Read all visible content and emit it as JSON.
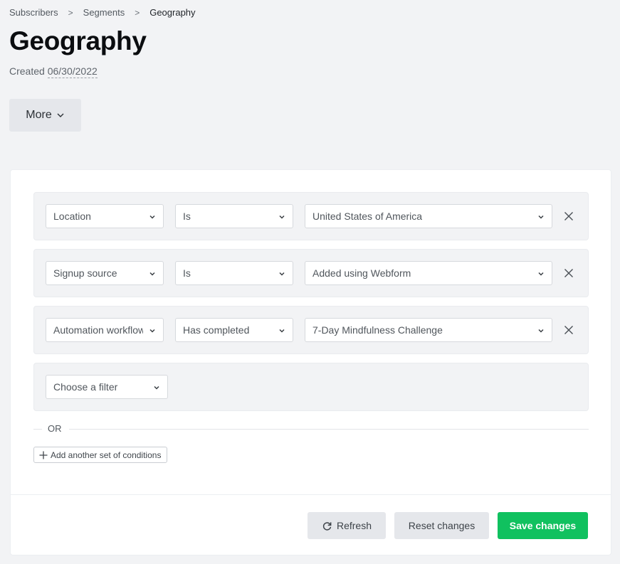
{
  "breadcrumb": {
    "items": [
      "Subscribers",
      "Segments",
      "Geography"
    ],
    "separator": ">"
  },
  "header": {
    "title": "Geography",
    "created_label": "Created",
    "created_date": "06/30/2022",
    "more_label": "More"
  },
  "conditions": [
    {
      "field": "Location",
      "operator": "Is",
      "value": "United States of America"
    },
    {
      "field": "Signup source",
      "operator": "Is",
      "value": "Added using Webform"
    },
    {
      "field": "Automation workflow",
      "operator": "Has completed",
      "value": "7-Day Mindfulness Challenge"
    }
  ],
  "new_filter": {
    "placeholder": "Choose a filter"
  },
  "or_label": "OR",
  "add_set_label": "Add another set of conditions",
  "footer": {
    "refresh_label": "Refresh",
    "reset_label": "Reset changes",
    "save_label": "Save changes"
  },
  "colors": {
    "primary": "#10c15f",
    "background": "#f2f3f5",
    "neutral_button": "#e5e7eb"
  },
  "icons": {
    "dropdown": "chevron-down-icon",
    "remove": "close-icon",
    "add": "plus-icon",
    "refresh": "refresh-icon"
  }
}
